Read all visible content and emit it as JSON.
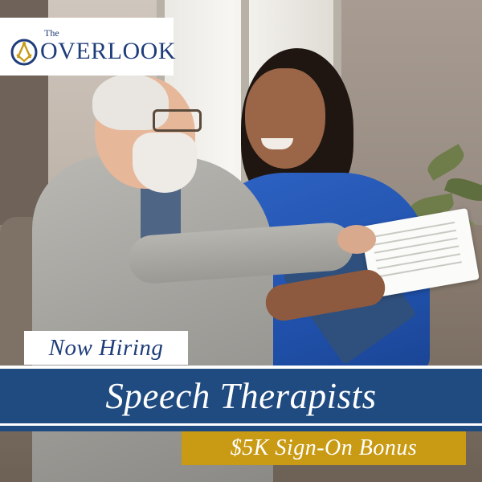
{
  "logo": {
    "small_text": "The",
    "main_text": "OVERLOOK",
    "icon": "masonic-compass-icon",
    "brand_color": "#1f3d7a",
    "accent_color": "#c99a14"
  },
  "photo": {
    "icon": "caregiver-with-senior-photo"
  },
  "ad": {
    "tag": "Now Hiring",
    "headline": "Speech Therapists",
    "bonus": "$5K Sign-On Bonus"
  },
  "colors": {
    "band": "#1f4b80",
    "bonus_bg": "#c99a14",
    "text_light": "#ffffff"
  }
}
